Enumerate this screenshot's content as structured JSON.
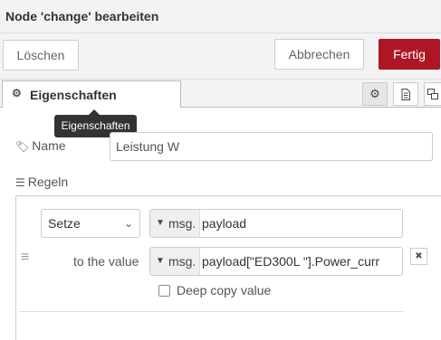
{
  "window": {
    "title": "Node 'change' bearbeiten"
  },
  "actions": {
    "delete_label": "Löschen",
    "cancel_label": "Abbrechen",
    "done_label": "Fertig"
  },
  "tabs": {
    "active_label": "Eigenschaften",
    "icons": [
      "gear-icon",
      "document-icon",
      "appearance-icon"
    ]
  },
  "tooltip": {
    "text": "Eigenschaften"
  },
  "name_field": {
    "label": "Name",
    "value": "Leistung W"
  },
  "rules": {
    "label": "Regeln",
    "rule": {
      "action": "Setze",
      "target_type": "msg.",
      "target_value": "payload",
      "to_label": "to the value",
      "value_type": "msg.",
      "value": "payload[\"ED300L \"].Power_curr",
      "deep_copy_label": "Deep copy value",
      "deep_copy_checked": false
    }
  },
  "colors": {
    "primary": "#ad1625",
    "header_bg": "#f3f3f3"
  }
}
